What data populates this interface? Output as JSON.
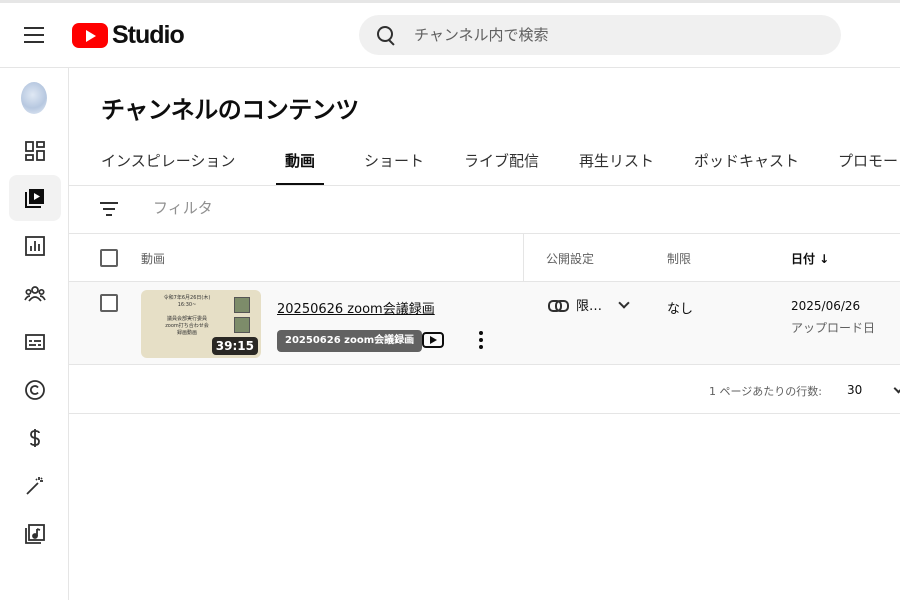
{
  "header": {
    "logo_text": "Studio",
    "search_placeholder": "チャンネル内で検索"
  },
  "sidebar": {
    "items": [
      {
        "icon": "dashboard-icon",
        "active": false
      },
      {
        "icon": "content-icon",
        "active": true
      },
      {
        "icon": "analytics-icon",
        "active": false
      },
      {
        "icon": "community-icon",
        "active": false
      },
      {
        "icon": "subtitles-icon",
        "active": false
      },
      {
        "icon": "copyright-icon",
        "active": false
      },
      {
        "icon": "earn-icon",
        "active": false
      },
      {
        "icon": "customization-icon",
        "active": false
      },
      {
        "icon": "audio-library-icon",
        "active": false
      }
    ]
  },
  "page": {
    "title": "チャンネルのコンテンツ"
  },
  "tabs": [
    {
      "label": "インスピレーション"
    },
    {
      "label": "動画",
      "active": true
    },
    {
      "label": "ショート"
    },
    {
      "label": "ライブ配信"
    },
    {
      "label": "再生リスト"
    },
    {
      "label": "ポッドキャスト"
    },
    {
      "label": "プロモー"
    }
  ],
  "filter": {
    "placeholder": "フィルタ"
  },
  "table": {
    "columns": {
      "video": "動画",
      "visibility": "公開設定",
      "restrictions": "制限",
      "date": "日付 ↓"
    },
    "rows": [
      {
        "title": "20250626 zoom会議録画",
        "tooltip": "20250626 zoom会議録画",
        "duration": "39:15",
        "thumb_lines": [
          "令和7年6月26日(木)",
          "16:30~",
          "",
          "議員会部実行委員",
          "zoom打ち合わせ会",
          "録画動画"
        ],
        "visibility": "限…",
        "restriction": "なし",
        "date": "2025/06/26",
        "date_sub": "アップロード日"
      }
    ]
  },
  "pagination": {
    "rows_per_page_label": "1 ページあたりの行数:",
    "rows_per_page_value": "30"
  },
  "colors": {
    "brand_red": "#ff0000",
    "active_bg": "#f2f2f2",
    "divider": "#e5e5e5"
  }
}
